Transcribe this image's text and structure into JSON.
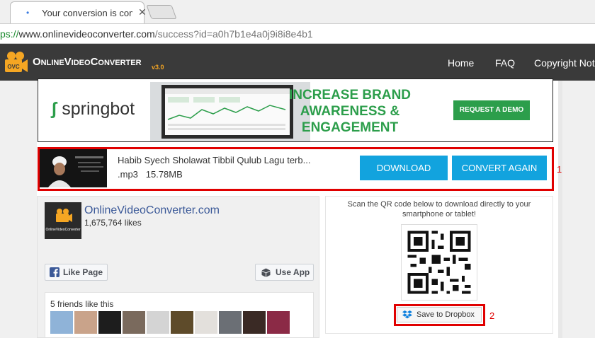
{
  "browser": {
    "tab_title": "Your conversion is comp",
    "tab_close": "✕",
    "url_scheme": "ps://",
    "url_host": "www.onlinevideoconverter.com",
    "url_path": "/success?id=a0h7b1e4a0j9i8i8e4b1"
  },
  "site": {
    "logo_text": "OnlineVideoConverter",
    "logo_version": "v3.0",
    "logo_badge": "OVC",
    "nav": [
      "Home",
      "FAQ",
      "Copyright Not"
    ]
  },
  "ad": {
    "brand": "springbot",
    "headline_lines": [
      "INCREASE BRAND",
      "AWARENESS &",
      "ENGAGEMENT"
    ],
    "cta": "REQUEST A DEMO",
    "accent": "#2c9e4b"
  },
  "conversion": {
    "title": "Habib Syech Sholawat Tibbil Qulub Lagu terb...",
    "format": ".mp3",
    "size": "15.78MB",
    "download_label": "DOWNLOAD",
    "convert_again_label": "CONVERT AGAIN",
    "button_color": "#12a3de"
  },
  "annotations": {
    "marker_1": "1",
    "marker_2": "2",
    "color": "#e00000"
  },
  "facebook": {
    "page_name": "OnlineVideoConverter.com",
    "likes": "1,675,764 likes",
    "avatar_text": "OnlineVideoConverter",
    "like_page_label": "Like Page",
    "use_app_label": "Use App",
    "friends_text": "5 friends like this"
  },
  "qr": {
    "instructions": "Scan the QR code below to download directly to your smartphone or tablet!",
    "dropbox_label": "Save to Dropbox"
  }
}
